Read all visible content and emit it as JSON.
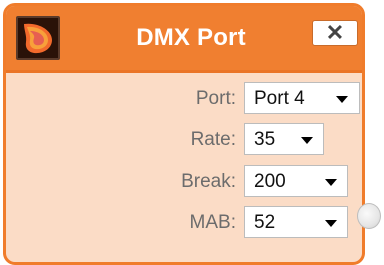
{
  "window": {
    "title": "DMX Port",
    "close_label": "✕",
    "app_icon": "orange-petal-logo-icon"
  },
  "fields": {
    "port": {
      "label": "Port:",
      "value": "Port 4"
    },
    "rate": {
      "label": "Rate:",
      "value": "35"
    },
    "break": {
      "label": "Break:",
      "value": "200"
    },
    "mab": {
      "label": "MAB:",
      "value": "52"
    }
  },
  "colors": {
    "titlebar": "#f07f30",
    "panel_body": "#fbdcc6",
    "border": "#f07c2b",
    "label_text": "#6c6c6c"
  },
  "icons": {
    "close": "close-icon",
    "caret": "chevron-down-icon",
    "connector": "output-connector-icon"
  }
}
